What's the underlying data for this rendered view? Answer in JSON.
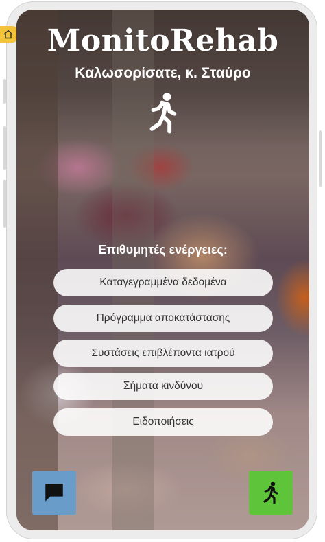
{
  "app": {
    "title": "MonitoRehab",
    "welcome": "Καλωσορίσατε, κ. Σταύρο"
  },
  "actions": {
    "heading": "Επιθυμητές ενέργειες:",
    "items": [
      {
        "label": "Καταγεγραμμένα δεδομένα"
      },
      {
        "label": "Πρόγραμμα αποκατάστασης"
      },
      {
        "label": "Συστάσεις επιβλέποντα ιατρού"
      },
      {
        "label": "Σήματα κινδύνου"
      },
      {
        "label": "Ειδοποιήσεις"
      }
    ]
  },
  "icons": {
    "home": "home-icon",
    "hero": "walking-person-icon",
    "chat": "chat-icon",
    "walk": "walking-person-icon"
  },
  "colors": {
    "home_badge": "#f2c23a",
    "chat_button": "#6a9cc9",
    "walk_button": "#5ec53a"
  }
}
